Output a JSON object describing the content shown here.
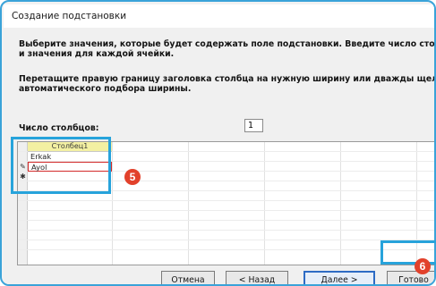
{
  "window": {
    "title": "Создание подстановки"
  },
  "instructions": {
    "line1": "Выберите значения, которые будет содержать поле подстановки. Введите число столбцов списка",
    "line2": "и значения для каждой ячейки.",
    "line3": "Перетащите правую границу заголовка столбца на нужную ширину или дважды щелкните ее для",
    "line4": "автоматического подбора ширины."
  },
  "columns": {
    "label": "Число столбцов:",
    "value": "1"
  },
  "grid": {
    "header": "Столбец1",
    "rows": [
      "Erkak",
      "Ayol"
    ],
    "edit_marker": "✎",
    "new_marker": "✱"
  },
  "buttons": {
    "cancel": "Отмена",
    "back": "< Назад",
    "next": "Далее >",
    "finish": "Готово"
  },
  "callouts": {
    "grid": "5",
    "finish": "6"
  },
  "colors": {
    "accent": "#27a3db",
    "badge": "#e2412b",
    "header": "#f3f0a2"
  }
}
